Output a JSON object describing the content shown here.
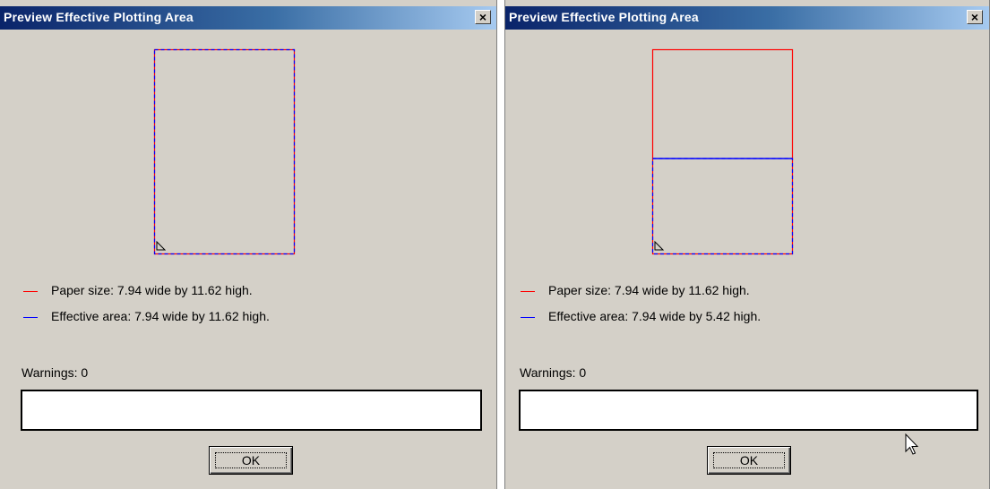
{
  "dialogs": [
    {
      "title": "Preview Effective Plotting Area",
      "close_label": "×",
      "paper": {
        "width": 7.94,
        "height": 11.62
      },
      "effective": {
        "width": 7.94,
        "height": 11.62
      },
      "paper_label": "Paper size: 7.94 wide by 11.62 high.",
      "effective_label": "Effective area: 7.94 wide by 11.62 high.",
      "warnings_label": "Warnings: 0",
      "warnings_text": "",
      "ok_label": "OK"
    },
    {
      "title": "Preview Effective Plotting Area",
      "close_label": "×",
      "paper": {
        "width": 7.94,
        "height": 11.62
      },
      "effective": {
        "width": 7.94,
        "height": 5.42
      },
      "paper_label": "Paper size: 7.94 wide by 11.62 high.",
      "effective_label": "Effective area: 7.94 wide by 5.42 high.",
      "warnings_label": "Warnings: 0",
      "warnings_text": "",
      "ok_label": "OK"
    }
  ],
  "colors": {
    "paper": "#ff0000",
    "effective": "#0000ff",
    "title_start": "#0a246a",
    "face": "#d4d0c8"
  },
  "icons": {
    "close": "close-icon",
    "cursor": "mouse-pointer-icon",
    "origin": "origin-corner-icon"
  }
}
